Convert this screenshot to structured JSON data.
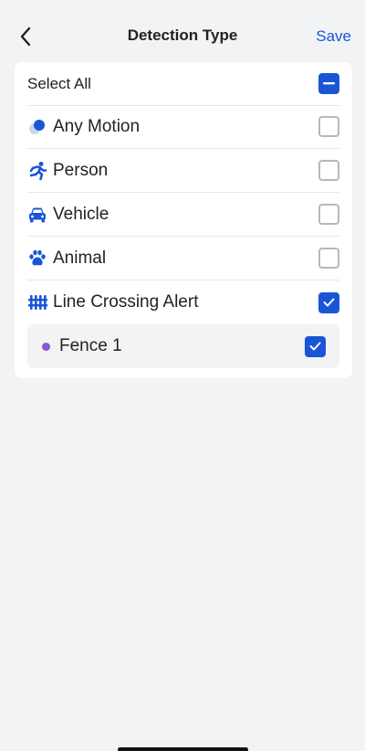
{
  "header": {
    "title": "Detection Type",
    "save_label": "Save"
  },
  "select_all": {
    "label": "Select All",
    "state": "indeterminate"
  },
  "options": [
    {
      "label": "Any Motion",
      "icon": "motion-dot-icon",
      "checked": false
    },
    {
      "label": "Person",
      "icon": "running-person-icon",
      "checked": false
    },
    {
      "label": "Vehicle",
      "icon": "car-icon",
      "checked": false
    },
    {
      "label": "Animal",
      "icon": "paw-icon",
      "checked": false
    },
    {
      "label": "Line Crossing Alert",
      "icon": "fence-icon",
      "checked": true
    }
  ],
  "fences": [
    {
      "label": "Fence 1",
      "color": "#8a55d8",
      "checked": true
    }
  ],
  "colors": {
    "accent": "#1a55d8",
    "background": "#f2f3f5"
  }
}
